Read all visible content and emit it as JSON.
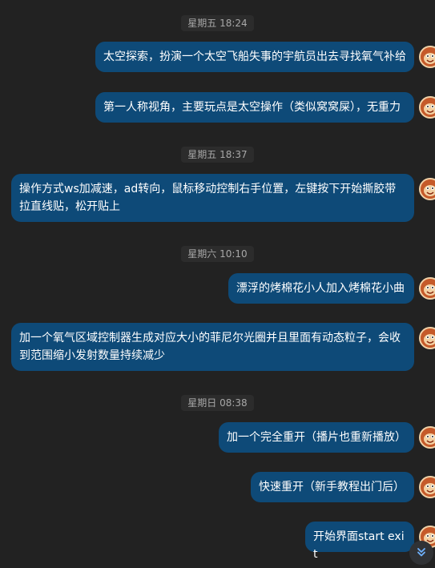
{
  "timestamps": [
    "星期五 18:24",
    "星期五 18:37",
    "星期六 10:10",
    "星期日 08:38"
  ],
  "messages": [
    {
      "text": "太空探索，扮演一个太空飞船失事的宇航员出去寻找氧气补给"
    },
    {
      "text": "第一人称视角，主要玩点是太空操作（类似窝窝屎），无重力"
    },
    {
      "text": "操作方式ws加减速，ad转向，鼠标移动控制右手位置，左键按下开始撕胶带拉直线贴，松开贴上"
    },
    {
      "text": "漂浮的烤棉花小人加入烤棉花小曲"
    },
    {
      "text": "加一个氧气区域控制器生成对应大小的菲尼尔光圈并且里面有动态粒子，会收到范围缩小发射数量持续减少"
    },
    {
      "text": "加一个完全重开（播片也重新播放）"
    },
    {
      "text": "快速重开（新手教程出门后）"
    },
    {
      "text": "开始界面start exit"
    }
  ],
  "colors": {
    "background": "#222222",
    "bubble": "#0e4a78",
    "timestamp_text": "#a8a8a8"
  },
  "icons": {
    "avatar": "monkey-avatar-icon",
    "scroll": "double-chevron-down-icon"
  }
}
